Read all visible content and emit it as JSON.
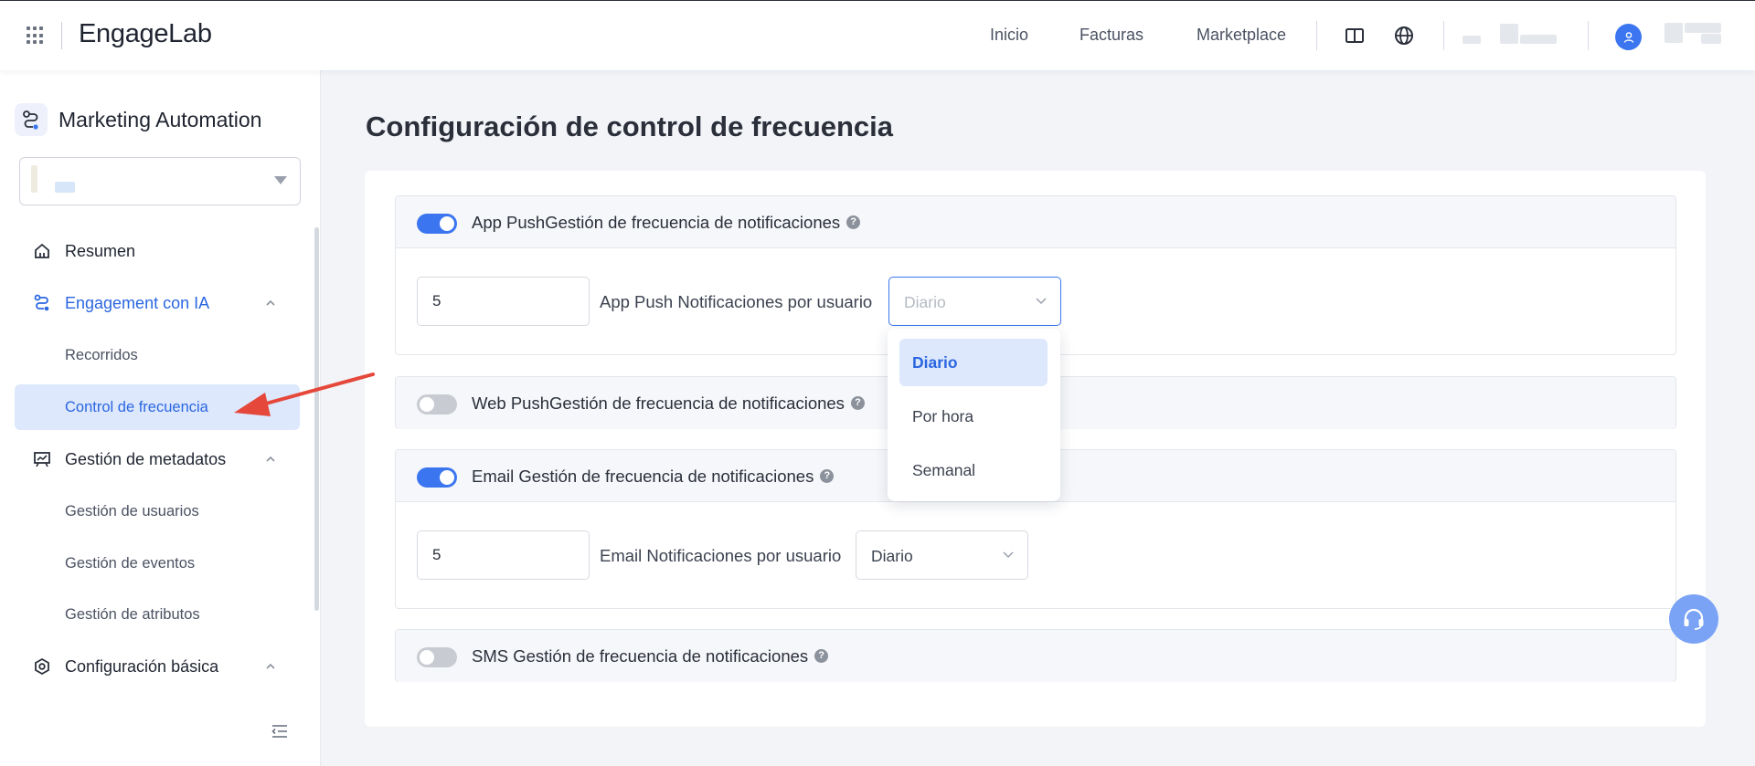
{
  "header": {
    "logo_text": "EngageLab",
    "nav": [
      {
        "label": "Inicio"
      },
      {
        "label": "Facturas"
      },
      {
        "label": "Marketplace"
      }
    ],
    "icons": [
      "grid-apps-icon",
      "book-icon",
      "globe-icon",
      "user-icon"
    ]
  },
  "sidebar": {
    "app_title": "Marketing Automation",
    "menu": {
      "resumen": "Resumen",
      "engagement": "Engagement con IA",
      "recorridos": "Recorridos",
      "control": "Control de frecuencia",
      "metadatos": "Gestión de metadatos",
      "usuarios": "Gestión de usuarios",
      "eventos": "Gestión de eventos",
      "atributos": "Gestión de atributos",
      "config": "Configuración básica"
    }
  },
  "main": {
    "title": "Configuración de control de frecuencia",
    "panels": [
      {
        "title": "App PushGestión de frecuencia de notificaciones",
        "enabled": true,
        "count": "5",
        "per_user_label": "App Push Notificaciones por usuario",
        "frequency": "Diario"
      },
      {
        "title": "Web PushGestión de frecuencia de notificaciones",
        "enabled": false
      },
      {
        "title": "Email Gestión de frecuencia de notificaciones",
        "enabled": true,
        "count": "5",
        "per_user_label": "Email Notificaciones por usuario",
        "frequency": "Diario"
      },
      {
        "title": "SMS Gestión de frecuencia de notificaciones",
        "enabled": false
      }
    ],
    "dropdown_options": [
      "Diario",
      "Por hora",
      "Semanal"
    ],
    "dropdown_selected": "Diario"
  },
  "colors": {
    "primary": "#3b76f0",
    "active_bg": "#dde8fc",
    "arrow": "#e5473a"
  }
}
